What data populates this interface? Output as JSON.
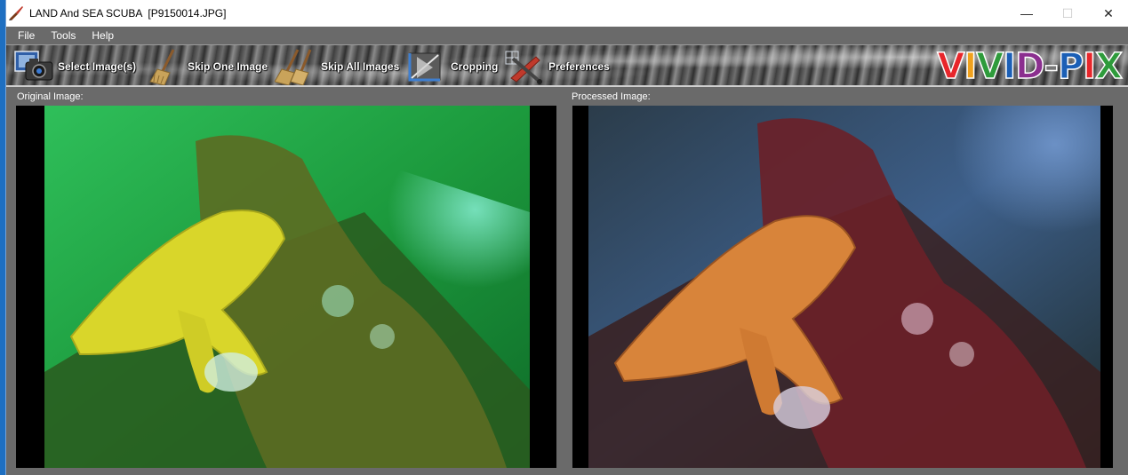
{
  "window": {
    "title": "LAND And SEA SCUBA  [P9150014.JPG]",
    "controls": {
      "minimize": "—",
      "maximize": "☐",
      "close": "✕"
    }
  },
  "menu": {
    "items": [
      "File",
      "Tools",
      "Help"
    ]
  },
  "toolbar": {
    "select_label": "Select Image(s)",
    "skip_one_label": "Skip One Image",
    "skip_all_label": "Skip All Images",
    "cropping_label": "Cropping",
    "preferences_label": "Preferences"
  },
  "logo": {
    "letters": [
      "V",
      "I",
      "V",
      "I",
      "D",
      "-",
      "P",
      "I",
      "X"
    ],
    "colors": [
      "#e8262b",
      "#f0a11d",
      "#2e9b3b",
      "#1b5fb6",
      "#8b2f8f",
      "#777777",
      "#1b5fb6",
      "#e8262b",
      "#2e9b3b"
    ]
  },
  "panels": {
    "original_label": "Original Image:",
    "processed_label": "Processed Image:"
  },
  "colors": {
    "window_bg": "#6a6a6a",
    "original_water": "#1fa84a",
    "original_starfish": "#d9d62a",
    "processed_water": "#3d5f8a",
    "processed_starfish": "#d8843a"
  }
}
